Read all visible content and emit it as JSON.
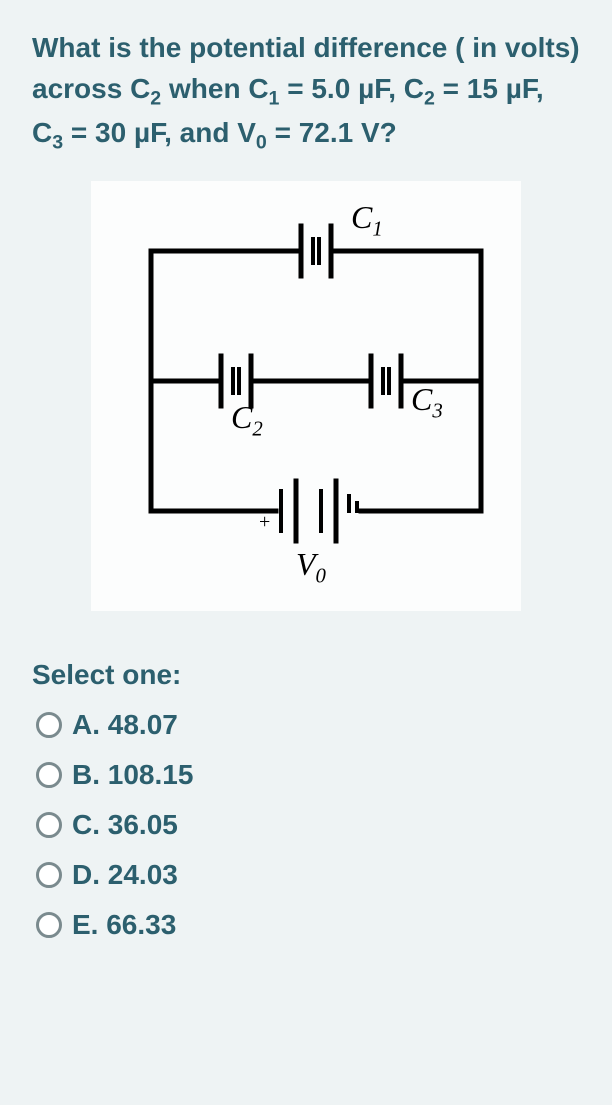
{
  "question": {
    "prefix": "What is the potential difference ( in volts) across C",
    "sub1": "2",
    "mid1": " when C",
    "sub2": "1",
    "mid2": " = 5.0 µF, C",
    "sub3": "2",
    "mid3": " = 15 µF, C",
    "sub4": "3",
    "mid4": " = 30 µF, and V",
    "sub5": "0",
    "suffix": " = 72.1 V?"
  },
  "circuit": {
    "labels": {
      "C1": "C",
      "C1sub": "1",
      "C2": "C",
      "C2sub": "2",
      "C3": "C",
      "C3sub": "3",
      "V0": "V",
      "V0sub": "0",
      "plus": "+"
    }
  },
  "prompt": "Select one:",
  "options": [
    {
      "id": "A",
      "label": "A. 48.07"
    },
    {
      "id": "B",
      "label": "B. 108.15"
    },
    {
      "id": "C",
      "label": "C. 36.05"
    },
    {
      "id": "D",
      "label": "D. 24.03"
    },
    {
      "id": "E",
      "label": "E. 66.33"
    }
  ]
}
